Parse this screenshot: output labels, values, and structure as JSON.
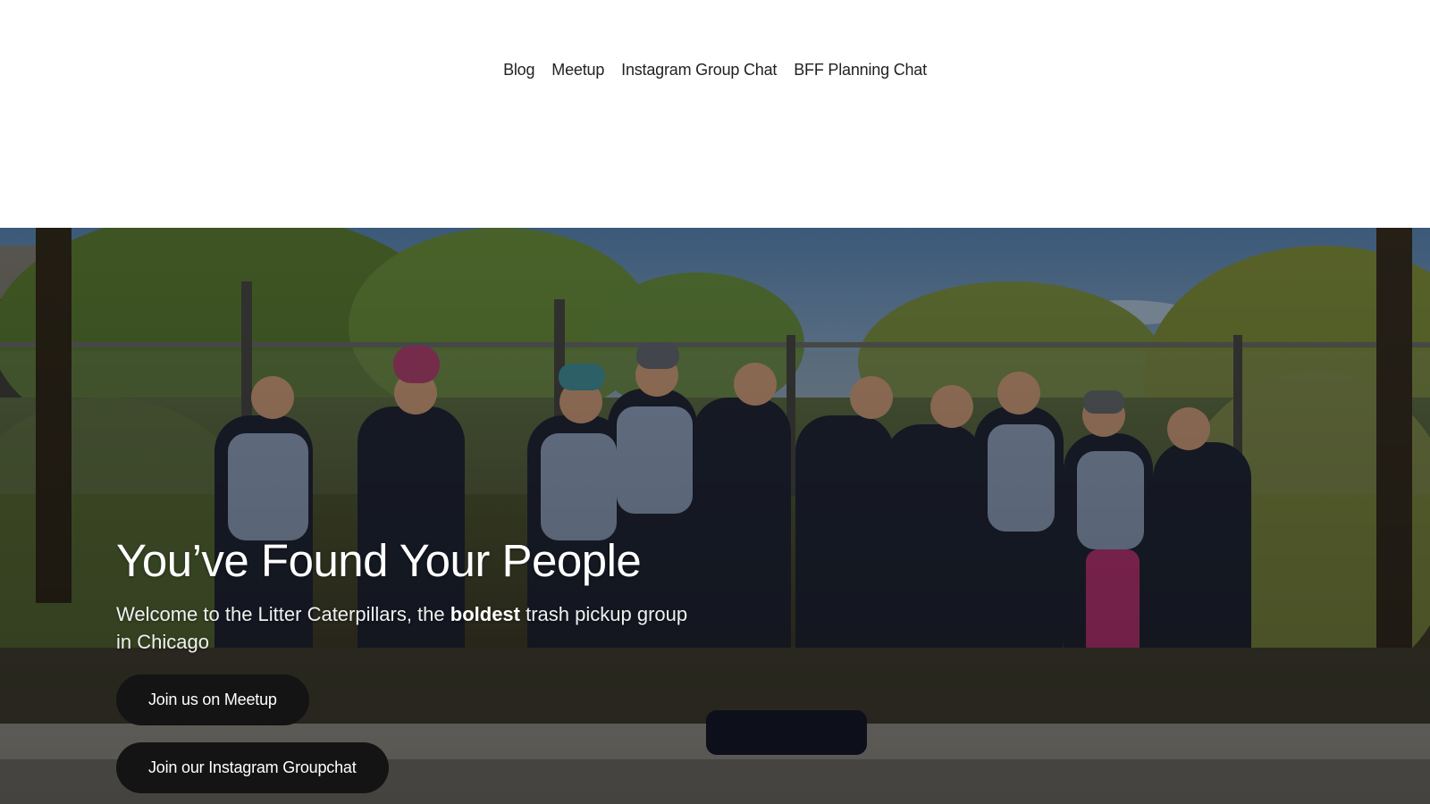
{
  "nav": {
    "items": [
      {
        "label": "Blog"
      },
      {
        "label": "Meetup"
      },
      {
        "label": "Instagram Group Chat"
      },
      {
        "label": "BFF Planning Chat"
      }
    ]
  },
  "hero": {
    "title": "You’ve Found Your People",
    "subtitle_before": "Welcome to the Litter Caterpillars, the ",
    "subtitle_bold": "boldest",
    "subtitle_after": " trash pickup group in Chicago",
    "buttons": {
      "meetup_label": "Join us on Meetup",
      "instagram_label": "Join our Instagram Groupchat"
    },
    "background_image": "group-photo-volunteers-by-fence"
  },
  "colors": {
    "nav_text": "#222222",
    "button_bg": "#141414",
    "button_text": "#ffffff",
    "hero_text": "#ffffff"
  }
}
